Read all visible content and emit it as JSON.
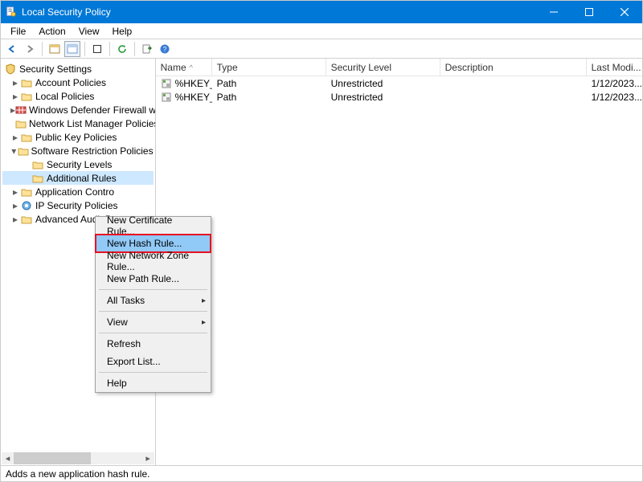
{
  "window": {
    "title": "Local Security Policy"
  },
  "menu": {
    "file": "File",
    "action": "Action",
    "view": "View",
    "help": "Help"
  },
  "tree": {
    "root": "Security Settings",
    "account_policies": "Account Policies",
    "local_policies": "Local Policies",
    "firewall": "Windows Defender Firewall with Adva",
    "netlist": "Network List Manager Policies",
    "pubkey": "Public Key Policies",
    "srp": "Software Restriction Policies",
    "sec_levels": "Security Levels",
    "add_rules": "Additional Rules",
    "app_control": "Application Contro",
    "ipsec": "IP Security Policies",
    "audit": "Advanced Audit Po"
  },
  "columns": {
    "name": "Name",
    "type": "Type",
    "security_level": "Security Level",
    "description": "Description",
    "last_modified": "Last Modi..."
  },
  "column_widths": {
    "name": 70,
    "type": 142,
    "security_level": 142,
    "description": 182,
    "last_modified": 60
  },
  "rows": [
    {
      "name": "%HKEY_LOC...",
      "type": "Path",
      "level": "Unrestricted",
      "desc": "",
      "mod": "1/12/2023..."
    },
    {
      "name": "%HKEY_LOC...",
      "type": "Path",
      "level": "Unrestricted",
      "desc": "",
      "mod": "1/12/2023..."
    }
  ],
  "context_menu": {
    "new_cert": "New Certificate Rule...",
    "new_hash": "New Hash Rule...",
    "new_zone": "New Network Zone Rule...",
    "new_path": "New Path Rule...",
    "all_tasks": "All Tasks",
    "view": "View",
    "refresh": "Refresh",
    "export": "Export List...",
    "help": "Help"
  },
  "status": "Adds a new application hash rule."
}
